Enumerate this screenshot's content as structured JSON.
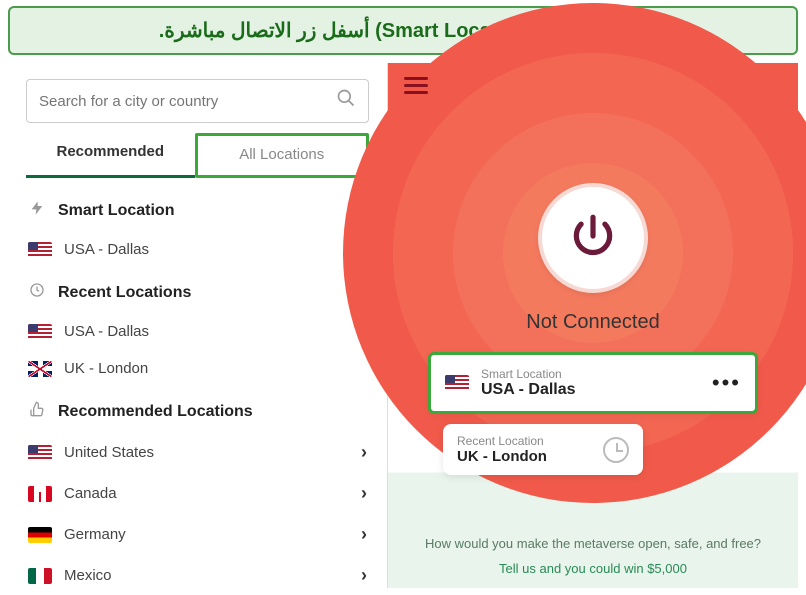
{
  "annotation": "الموقع الذكي (Smart Location) أسفل زر الاتصال مباشرة.",
  "search": {
    "placeholder": "Search for a city or country"
  },
  "tabs": {
    "recommended": "Recommended",
    "all": "All Locations"
  },
  "sections": {
    "smart": {
      "title": "Smart Location",
      "item": "USA - Dallas"
    },
    "recent": {
      "title": "Recent Locations",
      "item1": "USA - Dallas",
      "item2": "UK - London"
    },
    "reco": {
      "title": "Recommended Locations",
      "items": [
        "United States",
        "Canada",
        "Germany",
        "Mexico"
      ]
    }
  },
  "main": {
    "status": "Not Connected",
    "card": {
      "label": "Smart Location",
      "value": "USA - Dallas"
    },
    "recent": {
      "label": "Recent Location",
      "value": "UK - London"
    }
  },
  "promo": {
    "question": "How would you make the metaverse open, safe, and free?",
    "cta": "Tell us and you could win $5,000"
  }
}
